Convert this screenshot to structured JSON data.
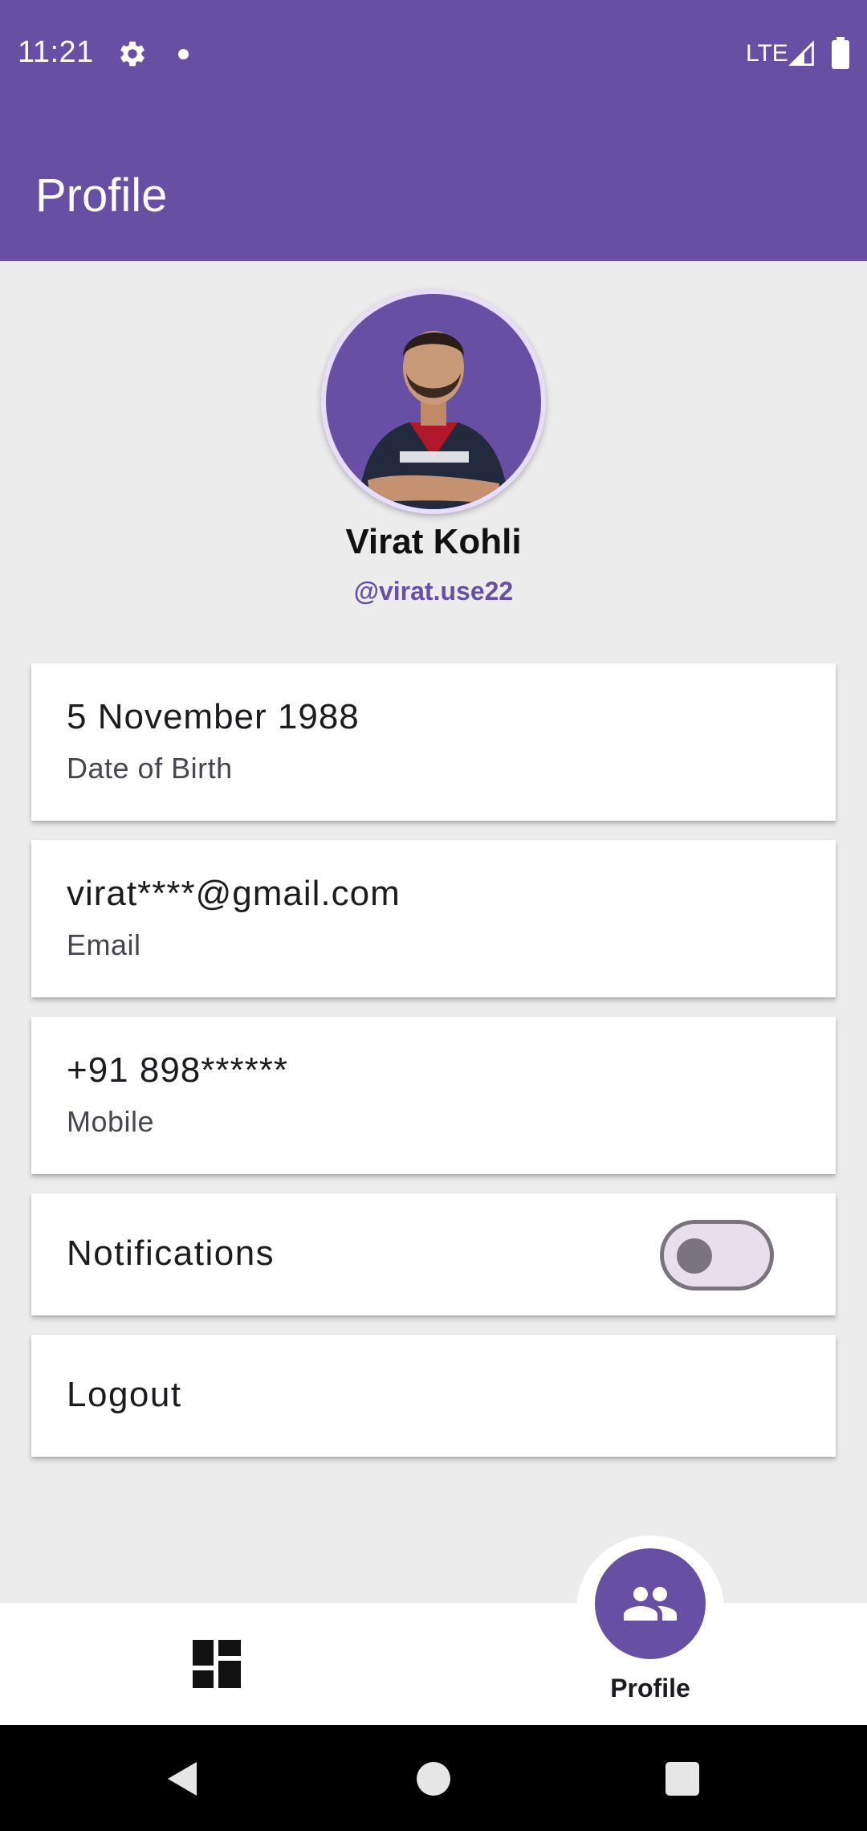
{
  "status_bar": {
    "time": "11:21",
    "network": "LTE"
  },
  "app_bar": {
    "title": "Profile"
  },
  "profile": {
    "name": "Virat Kohli",
    "handle": "@virat.use22"
  },
  "details": [
    {
      "value": "5 November 1988",
      "label": "Date of Birth"
    },
    {
      "value": "virat****@gmail.com",
      "label": "Email"
    },
    {
      "value": "+91 898******",
      "label": "Mobile"
    }
  ],
  "settings": {
    "notifications_label": "Notifications",
    "notifications_enabled": false,
    "logout_label": "Logout"
  },
  "bottom_nav": {
    "active_label": "Profile",
    "items": [
      "dashboard-icon",
      "people-icon"
    ]
  },
  "colors": {
    "primary": "#6750a4",
    "background": "#ececec",
    "card": "#ffffff"
  }
}
